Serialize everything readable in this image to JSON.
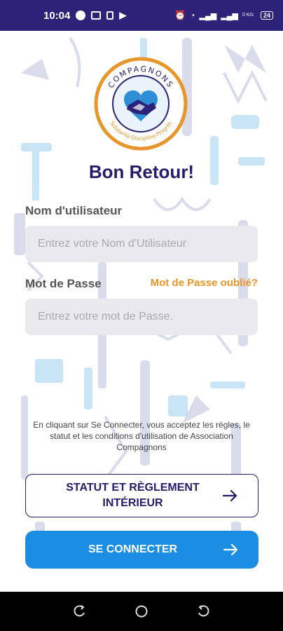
{
  "status_bar": {
    "time": "10:04",
    "battery": "24",
    "speed": "0 K/s"
  },
  "colors": {
    "brand_navy": "#231d6b",
    "accent_orange": "#e8962a",
    "primary_blue": "#1b8ee3"
  },
  "logo": {
    "text_top": "COMPAGNONS",
    "text_bottom": "Solidarité-Discipline-Progrès"
  },
  "login": {
    "title": "Bon Retour!",
    "username_label": "Nom d'utilisateur",
    "username_placeholder": "Entrez votre Nom d'Utilisateur",
    "password_label": "Mot de Passe",
    "forgot_password": "Mot de Passe oublié?",
    "password_placeholder": "Entrez votre mot de Passe.",
    "disclaimer": "En cliquant sur Se Connecter, vous acceptez les règles, le statut et les conditions d'utilisation de Association Compagnons",
    "rules_button_line1": "STATUT ET RÈGLEMENT",
    "rules_button_line2": "INTÉRIEUR",
    "connect_button": "SE CONNECTER"
  },
  "icons": {
    "arrow": "arrow-right-icon",
    "nav": [
      "recent-apps-icon",
      "home-icon",
      "back-icon"
    ]
  }
}
